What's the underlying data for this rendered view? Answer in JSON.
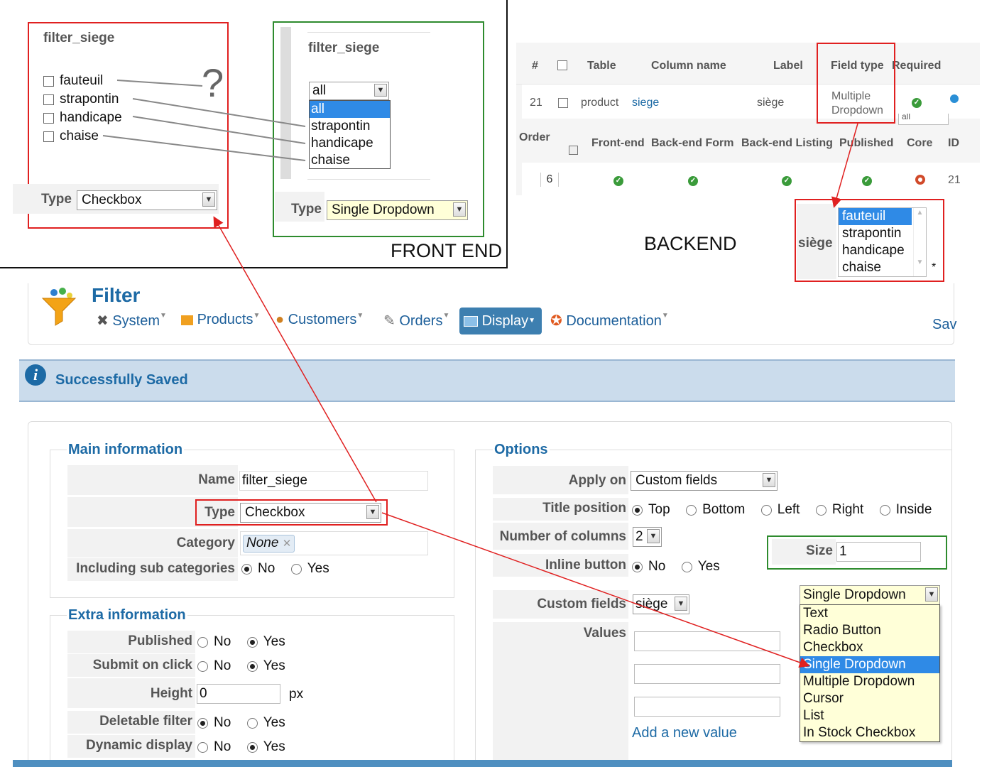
{
  "frontend_left": {
    "title": "filter_siege",
    "options": [
      "fauteuil",
      "strapontin",
      "handicape",
      "chaise"
    ],
    "question": "?",
    "type_label": "Type",
    "type_value": "Checkbox"
  },
  "frontend_right": {
    "title": "filter_siege",
    "dropdown_value": "all",
    "dropdown_options": [
      "all",
      "strapontin",
      "handicape",
      "chaise"
    ],
    "type_label": "Type",
    "type_value": "Single Dropdown"
  },
  "frontend_caption": "FRONT END",
  "backend_caption": "BACKEND",
  "backend_table": {
    "headers": [
      "#",
      "",
      "Table",
      "Column name",
      "Label",
      "Field type",
      "Required"
    ],
    "row": {
      "num": "21",
      "table": "product",
      "column": "siege",
      "label": "siège",
      "field_type_line1": "Multiple",
      "field_type_line2": "Dropdown"
    },
    "headers2": [
      "Order",
      "Front-end",
      "Back-end Form",
      "Back-end Listing",
      "Published",
      "Core",
      "ID"
    ],
    "row2": {
      "order": "6",
      "id": "21"
    },
    "partial_text": "all"
  },
  "backend_field": {
    "label": "siège",
    "options": [
      "fauteuil",
      "strapontin",
      "handicape",
      "chaise"
    ],
    "required_mark": "*"
  },
  "header": {
    "title": "Filter",
    "menu": [
      {
        "label": "System",
        "icon": "wrench-icon"
      },
      {
        "label": "Products",
        "icon": "box-icon"
      },
      {
        "label": "Customers",
        "icon": "users-icon"
      },
      {
        "label": "Orders",
        "icon": "orders-icon"
      },
      {
        "label": "Display",
        "icon": "display-icon"
      },
      {
        "label": "Documentation",
        "icon": "lifebuoy-icon"
      }
    ],
    "save_partial": "Sav"
  },
  "alert": {
    "text": "Successfully Saved"
  },
  "main_info": {
    "legend": "Main information",
    "name_label": "Name",
    "name_value": "filter_siege",
    "type_label": "Type",
    "type_value": "Checkbox",
    "category_label": "Category",
    "category_tag": "None",
    "subcat_label": "Including sub categories",
    "no": "No",
    "yes": "Yes"
  },
  "extra_info": {
    "legend": "Extra information",
    "published": "Published",
    "submit": "Submit on click",
    "height": "Height",
    "height_value": "0",
    "px": "px",
    "deletable": "Deletable filter",
    "dynamic": "Dynamic display",
    "no": "No",
    "yes": "Yes"
  },
  "options": {
    "legend": "Options",
    "apply_label": "Apply on",
    "apply_value": "Custom fields",
    "title_pos_label": "Title position",
    "positions": [
      "Top",
      "Bottom",
      "Left",
      "Right",
      "Inside"
    ],
    "columns_label": "Number of columns",
    "columns_value": "2",
    "inline_label": "Inline button",
    "no": "No",
    "yes": "Yes",
    "size_label": "Size",
    "size_value": "1",
    "custom_label": "Custom fields",
    "custom_value": "siège",
    "values_label": "Values",
    "add_value": "Add a new value"
  },
  "type_dropdown": {
    "selected": "Single Dropdown",
    "options": [
      "Text",
      "Radio Button",
      "Checkbox",
      "Single Dropdown",
      "Multiple Dropdown",
      "Cursor",
      "List",
      "In Stock Checkbox"
    ]
  },
  "colors": {
    "accent": "#1d6aa5",
    "red": "#e02020",
    "green": "#2e8b2e",
    "selection": "#2f8ae6",
    "display_btn": "#3d7fb0"
  }
}
